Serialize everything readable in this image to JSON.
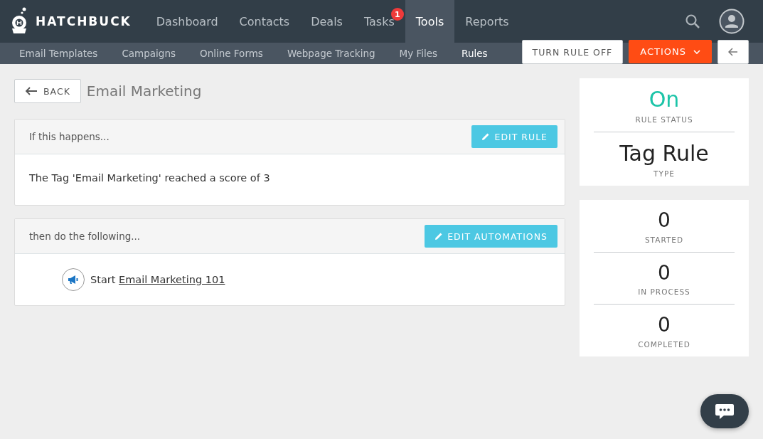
{
  "brand": "HATCHBUCK",
  "nav": [
    {
      "label": "Dashboard",
      "selected": false
    },
    {
      "label": "Contacts",
      "selected": false
    },
    {
      "label": "Deals",
      "selected": false
    },
    {
      "label": "Tasks",
      "selected": false,
      "badge": "1"
    },
    {
      "label": "Tools",
      "selected": true
    },
    {
      "label": "Reports",
      "selected": false
    }
  ],
  "subnav": [
    {
      "label": "Email Templates",
      "selected": false
    },
    {
      "label": "Campaigns",
      "selected": false
    },
    {
      "label": "Online Forms",
      "selected": false
    },
    {
      "label": "Webpage Tracking",
      "selected": false
    },
    {
      "label": "My Files",
      "selected": false
    },
    {
      "label": "Rules",
      "selected": true
    }
  ],
  "header": {
    "back": "BACK",
    "title": "Email Marketing",
    "turn_off": "TURN RULE OFF",
    "actions": "ACTIONS"
  },
  "trigger": {
    "heading": "If this happens...",
    "button": "EDIT RULE",
    "text": "The Tag 'Email Marketing' reached a score of 3"
  },
  "automations": {
    "heading": "then do the following...",
    "button": "EDIT AUTOMATIONS",
    "items": [
      {
        "prefix": "Start",
        "link": "Email Marketing 101"
      }
    ]
  },
  "status_card": [
    {
      "kind": "status",
      "value": "On",
      "label": "RULE STATUS"
    },
    {
      "kind": "type",
      "value": "Tag Rule",
      "label": "TYPE"
    }
  ],
  "counts": [
    {
      "value": "0",
      "label": "STARTED"
    },
    {
      "value": "0",
      "label": "IN PROCESS"
    },
    {
      "value": "0",
      "label": "COMPLETED"
    }
  ]
}
